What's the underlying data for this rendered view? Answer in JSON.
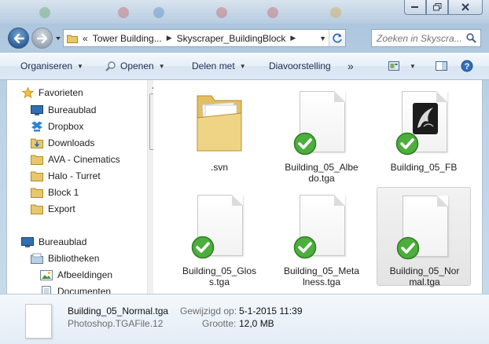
{
  "window": {
    "colors": {
      "accent": "#3a6ea5",
      "check": "#3ba33b",
      "selection": "#e6e6e6"
    }
  },
  "address": {
    "crumbs": [
      "Tower Building...",
      "Skyscraper_BuildingBlock"
    ],
    "prefix": "«"
  },
  "search": {
    "placeholder": "Zoeken in Skyscra..."
  },
  "toolbar": {
    "organize": "Organiseren",
    "open": "Openen",
    "share": "Delen met",
    "slideshow": "Diavoorstelling",
    "more": "»"
  },
  "nav": {
    "favorites_label": "Favorieten",
    "favorites": [
      {
        "label": "Bureaublad",
        "icon": "desktop-icon"
      },
      {
        "label": "Dropbox",
        "icon": "dropbox-icon"
      },
      {
        "label": "Downloads",
        "icon": "downloads-folder-icon"
      },
      {
        "label": "AVA - Cinematics",
        "icon": "folder-icon"
      },
      {
        "label": "Halo - Turret",
        "icon": "folder-icon"
      },
      {
        "label": "Block 1",
        "icon": "folder-icon"
      },
      {
        "label": "Export",
        "icon": "folder-icon"
      }
    ],
    "desktop_label": "Bureaublad",
    "libraries_label": "Bibliotheken",
    "libraries": [
      {
        "label": "Afbeeldingen",
        "icon": "pictures-icon"
      },
      {
        "label": "Documenten",
        "icon": "documents-icon"
      }
    ]
  },
  "files": [
    {
      "name": ".svn",
      "type": "folder",
      "synced": false,
      "selected": false
    },
    {
      "name": "Building_05_Albedo.tga",
      "type": "document",
      "synced": true,
      "selected": false
    },
    {
      "name": "Building_05_FB",
      "type": "maya",
      "synced": true,
      "selected": false
    },
    {
      "name": "Building_05_Gloss.tga",
      "type": "document",
      "synced": true,
      "selected": false
    },
    {
      "name": "Building_05_Metalness.tga",
      "type": "document",
      "synced": true,
      "selected": false
    },
    {
      "name": "Building_05_Normal.tga",
      "type": "document",
      "synced": true,
      "selected": true
    }
  ],
  "file_name_lines": [
    [
      "",
      ".svn"
    ],
    [
      "Building_05_Albe",
      "do.tga"
    ],
    [
      "Building_05_FB",
      ""
    ],
    [
      "Building_05_Glos",
      "s.tga"
    ],
    [
      "Building_05_Meta",
      "lness.tga"
    ],
    [
      "Building_05_Nor",
      "mal.tga"
    ]
  ],
  "details": {
    "name": "Building_05_Normal.tga",
    "type": "Photoshop.TGAFile.12",
    "modified_label": "Gewijzigd op:",
    "modified_value": "5-1-2015 11:39",
    "size_label": "Grootte:",
    "size_value": "12,0 MB"
  }
}
